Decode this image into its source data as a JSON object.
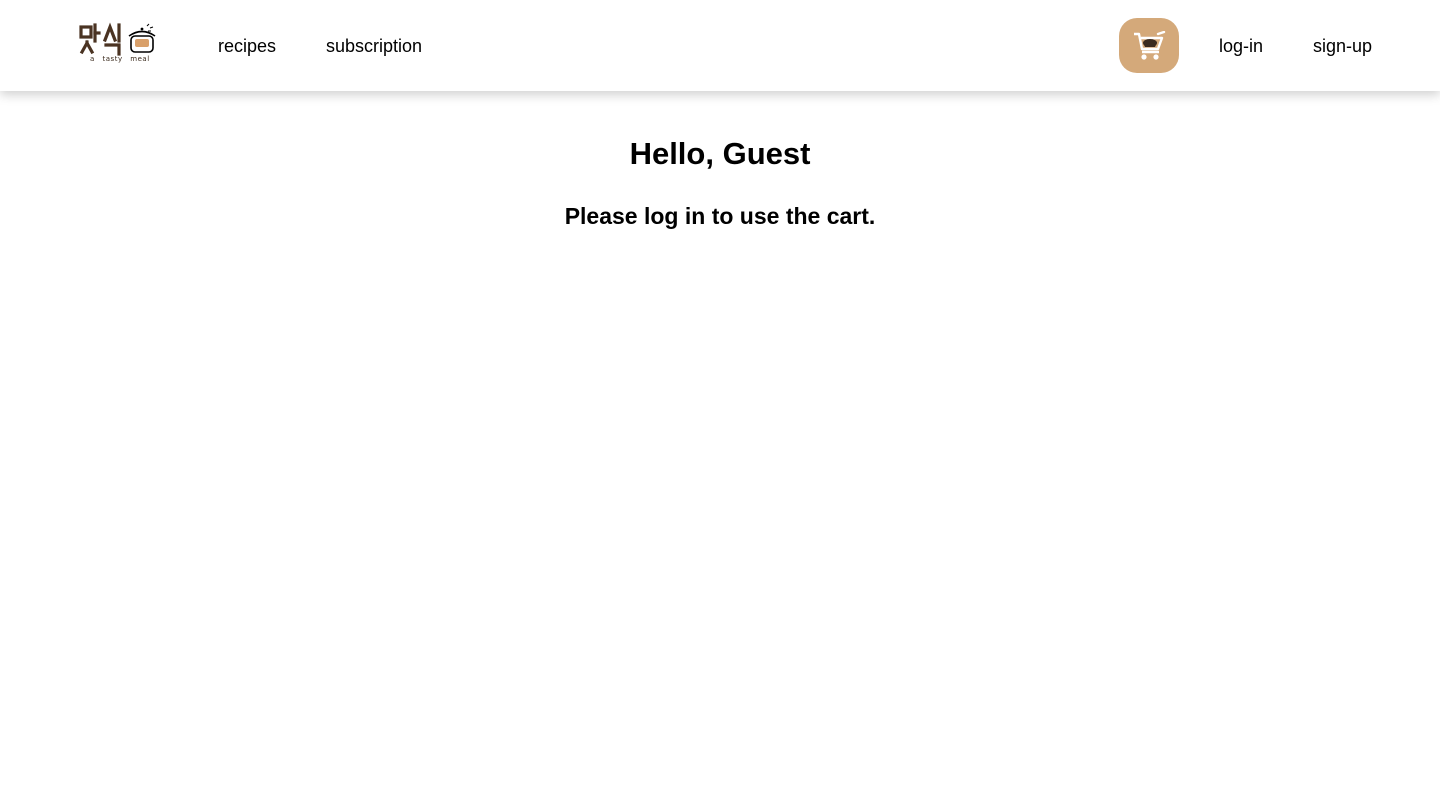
{
  "brand": {
    "logo_mark": "맛식",
    "tagline": "a tasty meal",
    "logo_color": "#4a3322",
    "logo_icon": "cooking-pot-icon"
  },
  "nav": {
    "recipes_label": "recipes",
    "subscription_label": "subscription",
    "login_label": "log-in",
    "signup_label": "sign-up"
  },
  "cart": {
    "icon": "shopping-cart-icon",
    "background_color": "#d4a97a"
  },
  "main": {
    "greeting": "Hello, Guest",
    "message": "Please log in to use the cart."
  }
}
